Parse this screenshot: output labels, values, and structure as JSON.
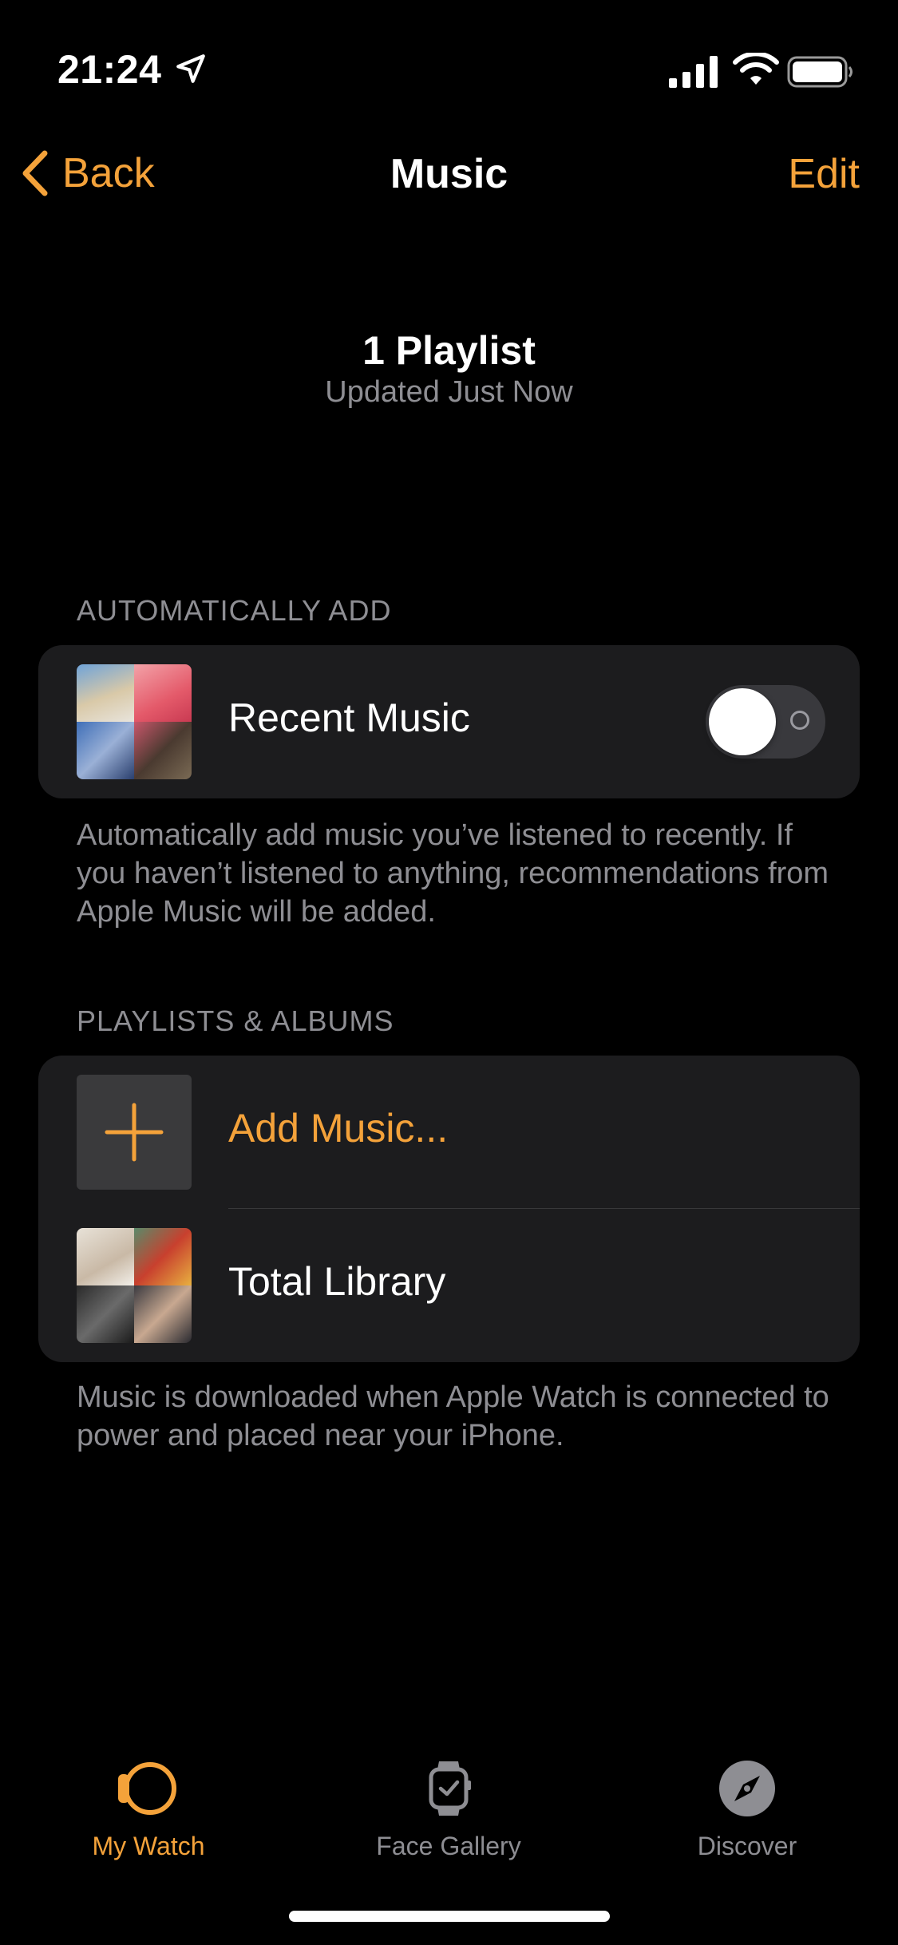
{
  "status_bar": {
    "time": "21:24"
  },
  "nav": {
    "back_label": "Back",
    "title": "Music",
    "edit_label": "Edit"
  },
  "header": {
    "title": "1 Playlist",
    "subtitle": "Updated Just Now"
  },
  "auto_add": {
    "section_label": "AUTOMATICALLY ADD",
    "row_label": "Recent Music",
    "toggle_on": false,
    "footnote": "Automatically add music you’ve listened to recently. If you haven’t listened to anything, recommendations from Apple Music will be added."
  },
  "playlists": {
    "section_label": "PLAYLISTS & ALBUMS",
    "add_label": "Add Music...",
    "library_label": "Total Library",
    "footnote": "Music is downloaded when Apple Watch is connected to power and placed near your iPhone."
  },
  "tab_bar": {
    "tabs": [
      {
        "label": "My Watch",
        "icon": "watch-icon",
        "active": true
      },
      {
        "label": "Face Gallery",
        "icon": "face-gallery-icon",
        "active": false
      },
      {
        "label": "Discover",
        "icon": "compass-icon",
        "active": false
      }
    ]
  },
  "colors": {
    "accent": "#F4A23A",
    "background": "#000000",
    "card": "#1C1C1E",
    "secondary_text": "#8E8E93"
  }
}
